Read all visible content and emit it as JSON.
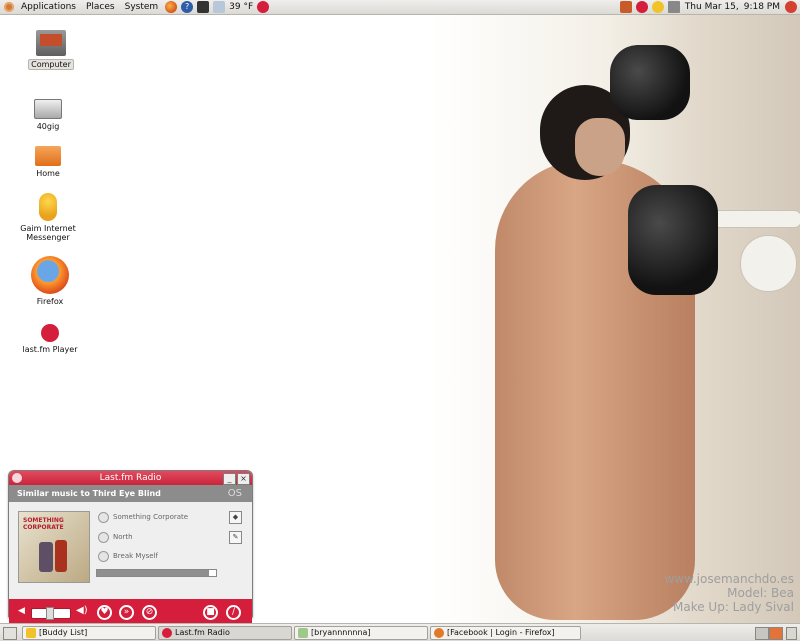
{
  "panel": {
    "menus": [
      "Applications",
      "Places",
      "System"
    ],
    "weather": "39 °F",
    "clock": {
      "date": "Thu Mar 15,",
      "time": "9:18 PM"
    }
  },
  "desktop": {
    "icons": [
      {
        "label": "Computer",
        "icon": "computer-icon"
      },
      {
        "label": "40gig",
        "icon": "drive-icon"
      },
      {
        "label": "Home",
        "icon": "folder-icon"
      },
      {
        "label": "Gaim Internet Messenger",
        "icon": "gaim-icon"
      },
      {
        "label": "Firefox",
        "icon": "firefox-icon"
      },
      {
        "label": "last.fm Player",
        "icon": "lastfm-icon"
      }
    ],
    "watermark": [
      "www.josemanchdo.es",
      "Model: Bea",
      "Make Up: Lady Sival"
    ]
  },
  "player": {
    "title": "Last.fm Radio",
    "station": "Similar music to Third Eye Blind",
    "station_badge": "OS",
    "album_cover_text": "SOMETHING CORPORATE",
    "tracks": [
      "Something Corporate",
      "North",
      "Break Myself"
    ],
    "progress": 0.94
  },
  "taskbar": {
    "tasks": [
      "[Buddy List]",
      "Last.fm Radio",
      "[bryannnnnna]",
      "[Facebook | Login - Firefox]"
    ]
  }
}
